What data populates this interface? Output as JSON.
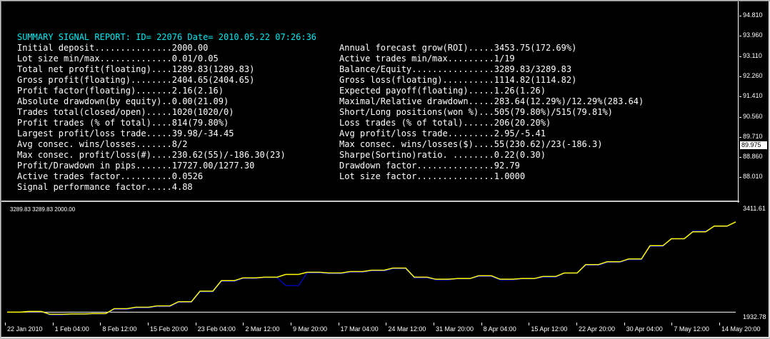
{
  "report": {
    "title": "SUMMARY SIGNAL REPORT: ID= 22076 Date= 2010.05.22 07:26:36",
    "left": [
      "Initial deposit...............2000.00",
      "Lot size min/max..............0.01/0.05",
      "Total net profit(floating)....1289.83(1289.83)",
      "Gross profit(floating)........2404.65(2404.65)",
      "Profit factor(floating).......2.16(2.16)",
      "Absolute drawdown(by equity)..0.00(21.09)",
      "Trades total(closed/open).....1020(1020/0)",
      "Profit trades (% of total)....814(79.80%)",
      "Largest profit/loss trade.....39.98/-34.45",
      "Avg consec. wins/losses.......8/2",
      "Max consec. profit/loss(#)....230.62(55)/-186.30(23)",
      "Profit/Drawdown in pips.......17727.00/1277.30",
      "Active trades factor..........0.0526",
      "Signal performance factor.....4.88"
    ],
    "right": [
      "Annual forecast grow(ROI).....3453.75(172.69%)",
      "Active trades min/max.........1/19",
      "Balance/Equity................3289.83/3289.83",
      "Gross loss(floating)..........1114.82(1114.82)",
      "Expected payoff(floating).....1.26(1.26)",
      "Maximal/Relative drawdown.....283.64(12.29%)/12.29%(283.64)",
      "Short/Long positions(won %)...505(79.80%)/515(79.81%)",
      "Loss trades (% of total)......206(20.20%)",
      "Avg profit/loss trade.........2.95/-5.41",
      "Max consec. wins/losses($)....55(230.62)/23(-186.3)",
      "Sharpe(Sortino)ratio. ........0.22(0.30)",
      "Drawdown factor...............92.79",
      "Lot size factor...............1.0000"
    ]
  },
  "upper_axis": {
    "labels": [
      "94.810",
      "93.960",
      "93.110",
      "92.260",
      "91.410",
      "90.560",
      "89.710",
      "88.860",
      "88.010"
    ],
    "current_price": "89.975"
  },
  "indicator": {
    "label": "3289.83 3289.83 2000.00",
    "axis_top": "3411.61",
    "axis_bottom": "1932.78"
  },
  "time_axis": {
    "labels": [
      "22 Jan 2010",
      "1 Feb 04:00",
      "8 Feb 12:00",
      "15 Feb 20:00",
      "23 Feb 04:00",
      "2 Mar 12:00",
      "9 Mar 20:00",
      "17 Mar 04:00",
      "24 Mar 12:00",
      "31 Mar 20:00",
      "8 Apr 04:00",
      "15 Apr 12:00",
      "22 Apr 20:00",
      "30 Apr 04:00",
      "7 May 12:00",
      "14 May 20:00"
    ]
  },
  "chart_data": {
    "type": "line",
    "title": "3289.83 3289.83 2000.00",
    "ylim": [
      1932.78,
      3411.61
    ],
    "x_labels": [
      "22 Jan 2010",
      "1 Feb 04:00",
      "8 Feb 12:00",
      "15 Feb 20:00",
      "23 Feb 04:00",
      "2 Mar 12:00",
      "9 Mar 20:00",
      "17 Mar 04:00",
      "24 Mar 12:00",
      "31 Mar 20:00",
      "8 Apr 04:00",
      "15 Apr 12:00",
      "22 Apr 20:00",
      "30 Apr 04:00",
      "7 May 12:00",
      "14 May 20:00"
    ],
    "series": [
      {
        "color": "#ffff00",
        "values": [
          2000,
          2010,
          1970,
          1975,
          1980,
          2050,
          2070,
          2090,
          2150,
          2300,
          2450,
          2490,
          2500,
          2540,
          2570,
          2560,
          2580,
          2600,
          2630,
          2500,
          2470,
          2480,
          2520,
          2470,
          2480,
          2510,
          2560,
          2680,
          2720,
          2760,
          2950,
          3050,
          3150,
          3230,
          3290
        ]
      },
      {
        "color": "#0000ff",
        "values": [
          2000,
          2005,
          1960,
          1970,
          1975,
          2040,
          2060,
          2080,
          2140,
          2290,
          2440,
          2480,
          2495,
          2380,
          2560,
          2550,
          2570,
          2590,
          2620,
          2490,
          2460,
          2475,
          2510,
          2460,
          2475,
          2500,
          2555,
          2670,
          2710,
          2750,
          2940,
          3045,
          3160,
          3225,
          3289.83
        ]
      },
      {
        "color": "#ffffff",
        "values": [
          2000,
          2000
        ]
      }
    ],
    "grid": false,
    "legend": "none"
  }
}
